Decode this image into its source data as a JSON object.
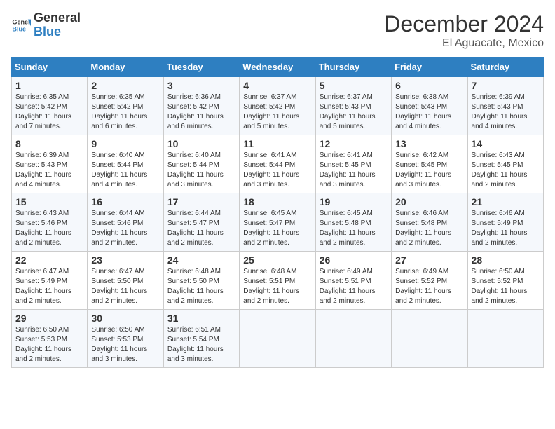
{
  "logo": {
    "text_general": "General",
    "text_blue": "Blue"
  },
  "header": {
    "month": "December 2024",
    "location": "El Aguacate, Mexico"
  },
  "weekdays": [
    "Sunday",
    "Monday",
    "Tuesday",
    "Wednesday",
    "Thursday",
    "Friday",
    "Saturday"
  ],
  "weeks": [
    [
      {
        "day": "1",
        "sunrise": "6:35 AM",
        "sunset": "5:42 PM",
        "daylight": "11 hours and 7 minutes."
      },
      {
        "day": "2",
        "sunrise": "6:35 AM",
        "sunset": "5:42 PM",
        "daylight": "11 hours and 6 minutes."
      },
      {
        "day": "3",
        "sunrise": "6:36 AM",
        "sunset": "5:42 PM",
        "daylight": "11 hours and 6 minutes."
      },
      {
        "day": "4",
        "sunrise": "6:37 AM",
        "sunset": "5:42 PM",
        "daylight": "11 hours and 5 minutes."
      },
      {
        "day": "5",
        "sunrise": "6:37 AM",
        "sunset": "5:43 PM",
        "daylight": "11 hours and 5 minutes."
      },
      {
        "day": "6",
        "sunrise": "6:38 AM",
        "sunset": "5:43 PM",
        "daylight": "11 hours and 4 minutes."
      },
      {
        "day": "7",
        "sunrise": "6:39 AM",
        "sunset": "5:43 PM",
        "daylight": "11 hours and 4 minutes."
      }
    ],
    [
      {
        "day": "8",
        "sunrise": "6:39 AM",
        "sunset": "5:43 PM",
        "daylight": "11 hours and 4 minutes."
      },
      {
        "day": "9",
        "sunrise": "6:40 AM",
        "sunset": "5:44 PM",
        "daylight": "11 hours and 4 minutes."
      },
      {
        "day": "10",
        "sunrise": "6:40 AM",
        "sunset": "5:44 PM",
        "daylight": "11 hours and 3 minutes."
      },
      {
        "day": "11",
        "sunrise": "6:41 AM",
        "sunset": "5:44 PM",
        "daylight": "11 hours and 3 minutes."
      },
      {
        "day": "12",
        "sunrise": "6:41 AM",
        "sunset": "5:45 PM",
        "daylight": "11 hours and 3 minutes."
      },
      {
        "day": "13",
        "sunrise": "6:42 AM",
        "sunset": "5:45 PM",
        "daylight": "11 hours and 3 minutes."
      },
      {
        "day": "14",
        "sunrise": "6:43 AM",
        "sunset": "5:45 PM",
        "daylight": "11 hours and 2 minutes."
      }
    ],
    [
      {
        "day": "15",
        "sunrise": "6:43 AM",
        "sunset": "5:46 PM",
        "daylight": "11 hours and 2 minutes."
      },
      {
        "day": "16",
        "sunrise": "6:44 AM",
        "sunset": "5:46 PM",
        "daylight": "11 hours and 2 minutes."
      },
      {
        "day": "17",
        "sunrise": "6:44 AM",
        "sunset": "5:47 PM",
        "daylight": "11 hours and 2 minutes."
      },
      {
        "day": "18",
        "sunrise": "6:45 AM",
        "sunset": "5:47 PM",
        "daylight": "11 hours and 2 minutes."
      },
      {
        "day": "19",
        "sunrise": "6:45 AM",
        "sunset": "5:48 PM",
        "daylight": "11 hours and 2 minutes."
      },
      {
        "day": "20",
        "sunrise": "6:46 AM",
        "sunset": "5:48 PM",
        "daylight": "11 hours and 2 minutes."
      },
      {
        "day": "21",
        "sunrise": "6:46 AM",
        "sunset": "5:49 PM",
        "daylight": "11 hours and 2 minutes."
      }
    ],
    [
      {
        "day": "22",
        "sunrise": "6:47 AM",
        "sunset": "5:49 PM",
        "daylight": "11 hours and 2 minutes."
      },
      {
        "day": "23",
        "sunrise": "6:47 AM",
        "sunset": "5:50 PM",
        "daylight": "11 hours and 2 minutes."
      },
      {
        "day": "24",
        "sunrise": "6:48 AM",
        "sunset": "5:50 PM",
        "daylight": "11 hours and 2 minutes."
      },
      {
        "day": "25",
        "sunrise": "6:48 AM",
        "sunset": "5:51 PM",
        "daylight": "11 hours and 2 minutes."
      },
      {
        "day": "26",
        "sunrise": "6:49 AM",
        "sunset": "5:51 PM",
        "daylight": "11 hours and 2 minutes."
      },
      {
        "day": "27",
        "sunrise": "6:49 AM",
        "sunset": "5:52 PM",
        "daylight": "11 hours and 2 minutes."
      },
      {
        "day": "28",
        "sunrise": "6:50 AM",
        "sunset": "5:52 PM",
        "daylight": "11 hours and 2 minutes."
      }
    ],
    [
      {
        "day": "29",
        "sunrise": "6:50 AM",
        "sunset": "5:53 PM",
        "daylight": "11 hours and 2 minutes."
      },
      {
        "day": "30",
        "sunrise": "6:50 AM",
        "sunset": "5:53 PM",
        "daylight": "11 hours and 3 minutes."
      },
      {
        "day": "31",
        "sunrise": "6:51 AM",
        "sunset": "5:54 PM",
        "daylight": "11 hours and 3 minutes."
      },
      null,
      null,
      null,
      null
    ]
  ]
}
